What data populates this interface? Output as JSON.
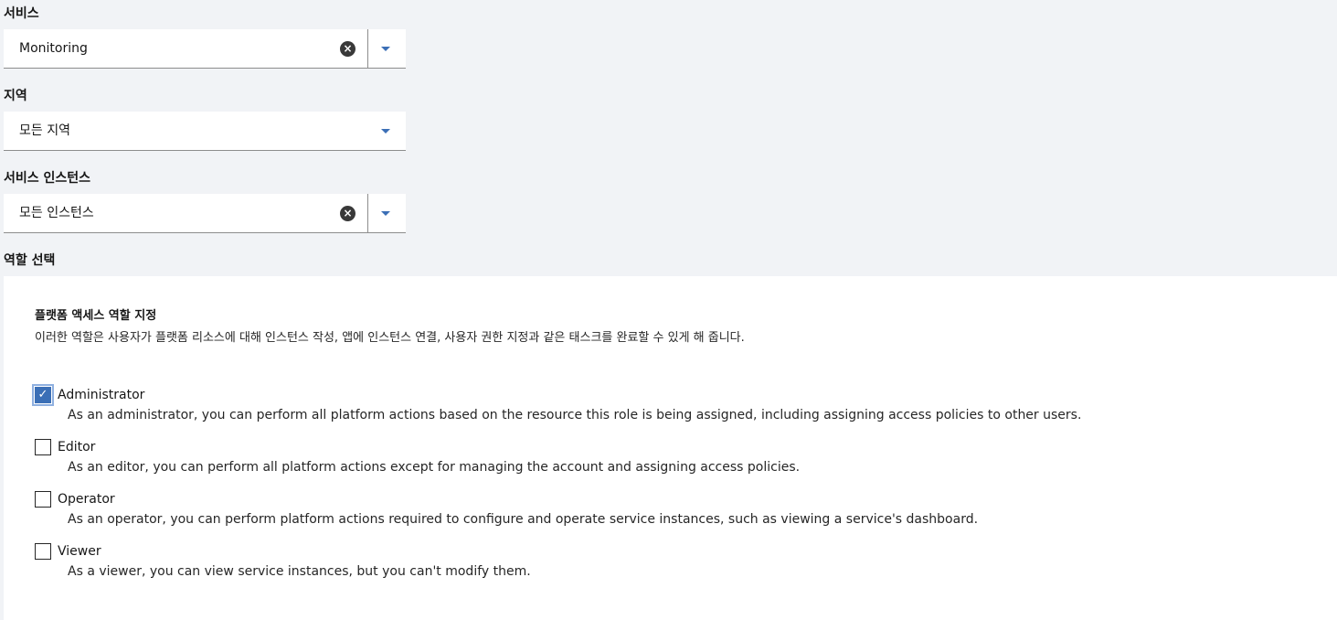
{
  "service": {
    "label": "서비스",
    "value": "Monitoring",
    "clear_icon": "close-circle-icon",
    "dropdown_icon": "caret-down-icon"
  },
  "region": {
    "label": "지역",
    "value": "모든 지역",
    "dropdown_icon": "caret-down-icon"
  },
  "service_instance": {
    "label": "서비스 인스턴스",
    "value": "모든 인스턴스",
    "clear_icon": "close-circle-icon",
    "dropdown_icon": "caret-down-icon"
  },
  "role_select": {
    "label": "역할 선택"
  },
  "platform_roles": {
    "title": "플랫폼 액세스 역할 지정",
    "description": "이러한 역할은 사용자가 플랫폼 리소스에 대해 인스턴스 작성, 앱에 인스턴스 연결, 사용자 권한 지정과 같은 태스크를 완료할 수 있게 해 줍니다.",
    "roles": [
      {
        "name": "Administrator",
        "description": "As an administrator, you can perform all platform actions based on the resource this role is being assigned, including assigning access policies to other users.",
        "checked": true
      },
      {
        "name": "Editor",
        "description": "As an editor, you can perform all platform actions except for managing the account and assigning access policies.",
        "checked": false
      },
      {
        "name": "Operator",
        "description": "As an operator, you can perform platform actions required to configure and operate service instances, such as viewing a service's dashboard.",
        "checked": false
      },
      {
        "name": "Viewer",
        "description": "As a viewer, you can view service instances, but you can't modify them.",
        "checked": false
      }
    ]
  },
  "colors": {
    "accent": "#3b6fb6",
    "background": "#f1f3f6",
    "panel": "#ffffff"
  }
}
